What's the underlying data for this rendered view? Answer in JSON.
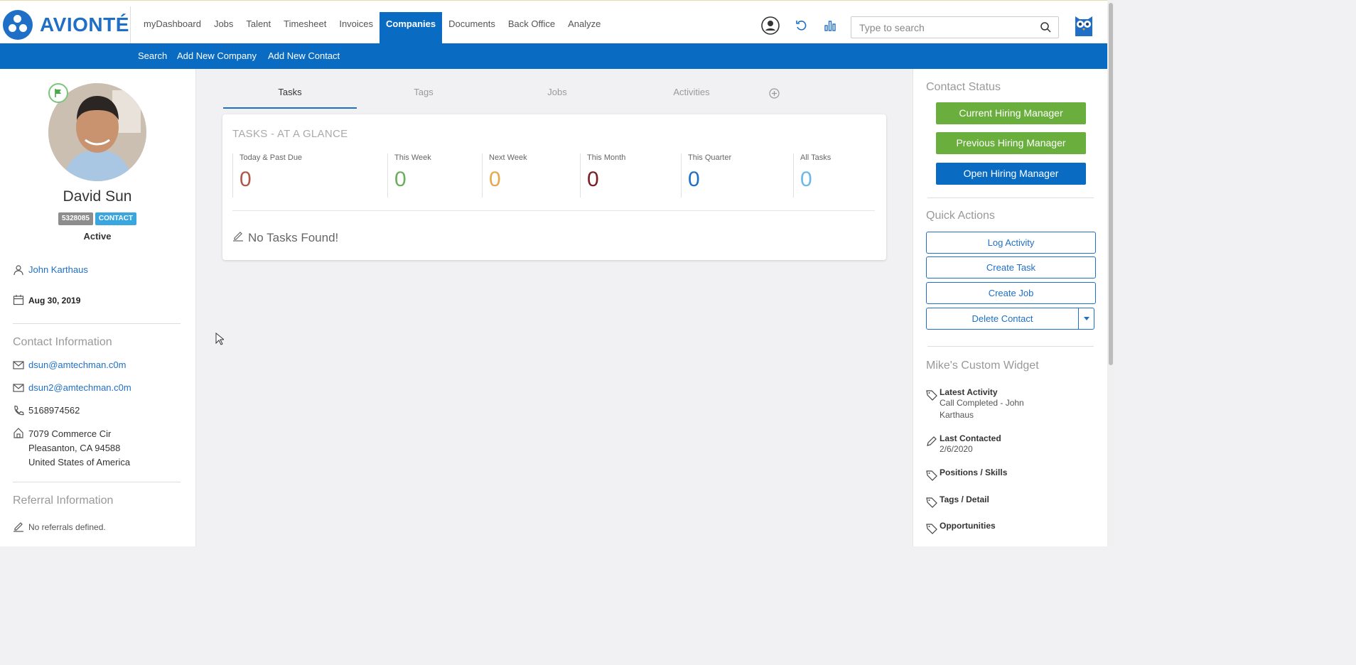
{
  "brand": {
    "name": "AVIONTÉ"
  },
  "nav": {
    "items": [
      {
        "label": "myDashboard"
      },
      {
        "label": "Jobs"
      },
      {
        "label": "Talent"
      },
      {
        "label": "Timesheet"
      },
      {
        "label": "Invoices"
      },
      {
        "label": "Companies",
        "active": true
      },
      {
        "label": "Documents"
      },
      {
        "label": "Back Office"
      },
      {
        "label": "Analyze"
      }
    ]
  },
  "search": {
    "placeholder": "Type to search"
  },
  "subnav": {
    "items": [
      {
        "label": "Search"
      },
      {
        "label": "Add New Company"
      },
      {
        "label": "Add New Contact"
      }
    ]
  },
  "contact": {
    "name": "David Sun",
    "id_badge": "5328085",
    "type_badge": "CONTACT",
    "status": "Active",
    "owner": "John Karthaus",
    "date": "Aug 30, 2019",
    "contact_info_title": "Contact Information",
    "email1": "dsun@amtechman.c0m",
    "email2": "dsun2@amtechman.c0m",
    "phone": "5168974562",
    "address_line1": "7079 Commerce Cir",
    "address_line2": "Pleasanton, CA 94588",
    "address_line3": "United States of America",
    "referral_title": "Referral Information",
    "referral_empty": "No referrals defined."
  },
  "tabs": [
    {
      "label": "Tasks",
      "active": true
    },
    {
      "label": "Tags"
    },
    {
      "label": "Jobs"
    },
    {
      "label": "Activities"
    }
  ],
  "tasks": {
    "title": "TASKS - AT A GLANCE",
    "stats": [
      {
        "label": "Today & Past Due",
        "value": "0",
        "color": "#b0574a"
      },
      {
        "label": "This Week",
        "value": "0",
        "color": "#6aaf5d"
      },
      {
        "label": "Next Week",
        "value": "0",
        "color": "#e6a84e"
      },
      {
        "label": "This Month",
        "value": "0",
        "color": "#7a1e1e"
      },
      {
        "label": "This Quarter",
        "value": "0",
        "color": "#1f6fc6"
      },
      {
        "label": "All Tasks",
        "value": "0",
        "color": "#6bb8e8"
      }
    ],
    "empty": "No Tasks Found!"
  },
  "right": {
    "contact_status_title": "Contact Status",
    "status_buttons": [
      {
        "label": "Current Hiring Manager"
      },
      {
        "label": "Previous Hiring Manager"
      },
      {
        "label": "Open Hiring Manager"
      }
    ],
    "quick_actions_title": "Quick Actions",
    "actions": [
      {
        "label": "Log Activity"
      },
      {
        "label": "Create Task"
      },
      {
        "label": "Create Job"
      },
      {
        "label": "Delete Contact"
      }
    ],
    "widget_title": "Mike's Custom Widget",
    "widget": {
      "latest_activity_label": "Latest Activity",
      "latest_activity_value": "Call Completed - John Karthaus",
      "last_contacted_label": "Last Contacted",
      "last_contacted_value": "2/6/2020",
      "positions_label": "Positions / Skills",
      "tags_label": "Tags / Detail",
      "opportunities_label": "Opportunities"
    }
  },
  "colors": {
    "brand_blue": "#0a6bc2",
    "green": "#6aaf3d"
  }
}
